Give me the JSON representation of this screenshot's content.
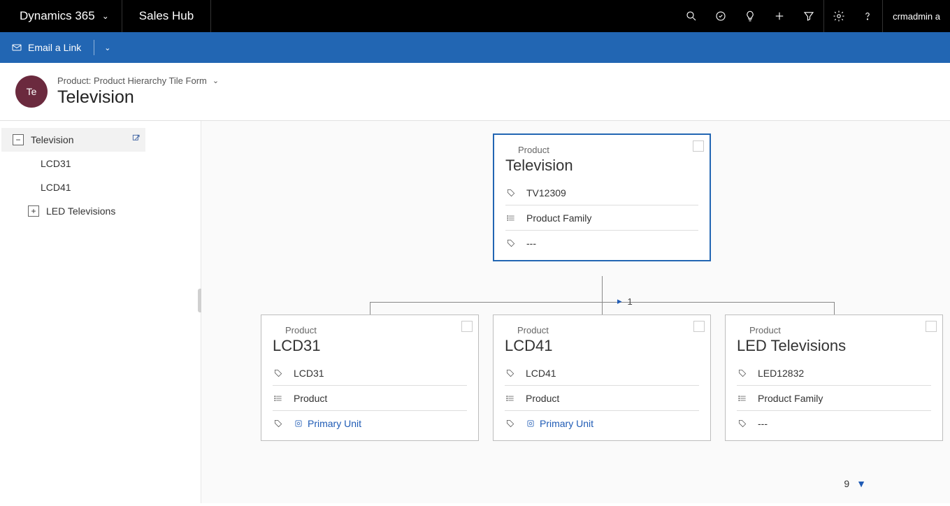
{
  "topbar": {
    "brand": "Dynamics 365",
    "app": "Sales Hub",
    "user": "crmadmin a"
  },
  "cmdbar": {
    "email_link": "Email a Link"
  },
  "header": {
    "avatar_text": "Te",
    "breadcrumb": "Product: Product Hierarchy Tile Form",
    "title": "Television"
  },
  "tree": {
    "root": "Television",
    "children": [
      "LCD31",
      "LCD41"
    ],
    "expandable": "LED Televisions"
  },
  "tiles": {
    "entity_label": "Product",
    "root": {
      "name": "Television",
      "code": "TV12309",
      "type": "Product Family",
      "unit": "---"
    },
    "children": [
      {
        "name": "LCD31",
        "code": "LCD31",
        "type": "Product",
        "unit": "Primary Unit",
        "unit_is_link": true
      },
      {
        "name": "LCD41",
        "code": "LCD41",
        "type": "Product",
        "unit": "Primary Unit",
        "unit_is_link": true
      },
      {
        "name": "LED Televisions",
        "code": "LED12832",
        "type": "Product Family",
        "unit": "---",
        "unit_is_link": false
      }
    ]
  },
  "pager": {
    "top": "1",
    "bottom": "9"
  }
}
